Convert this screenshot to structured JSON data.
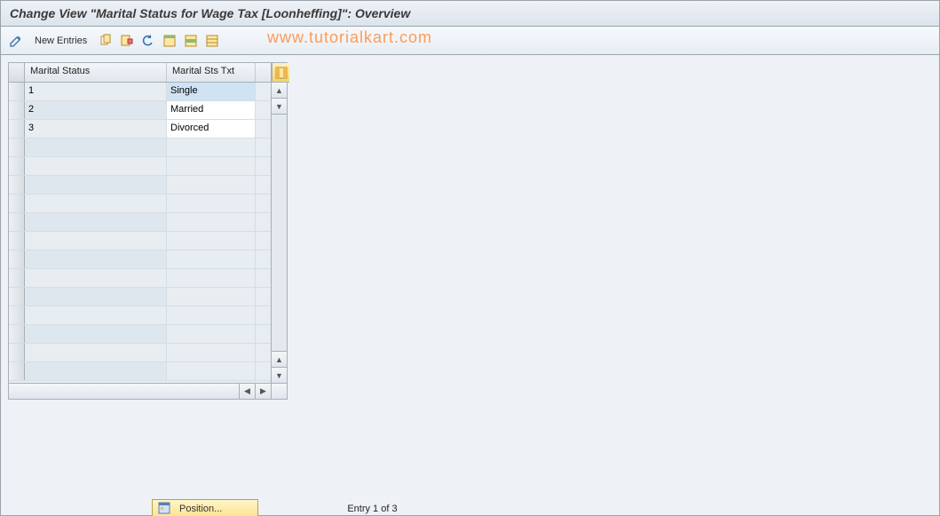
{
  "title": "Change View \"Marital Status for Wage Tax [Loonheffing]\": Overview",
  "toolbar": {
    "new_entries_label": "New Entries"
  },
  "watermark": "www.tutorialkart.com",
  "grid": {
    "col1_header": "Marital Status",
    "col2_header": "Marital Sts Txt",
    "rows": [
      {
        "status": "1",
        "text": "Single",
        "c2_selected": true
      },
      {
        "status": "2",
        "text": "Married",
        "c2_selected": false
      },
      {
        "status": "3",
        "text": "Divorced",
        "c2_selected": false
      }
    ],
    "blank_row_count": 13
  },
  "footer": {
    "position_label": "Position...",
    "entry_text": "Entry 1 of 3"
  }
}
